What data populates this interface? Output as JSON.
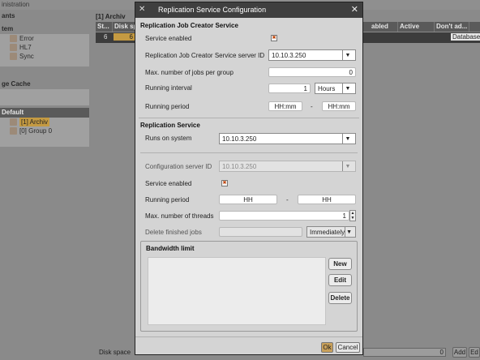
{
  "app": {
    "title_fragment": "inistration",
    "left_panel": {
      "heading1": "ants",
      "heading_system": "tem",
      "system_items": [
        "Error",
        "HL7",
        "Sync"
      ],
      "heading_cache": "ge Cache",
      "heading_default": "Default",
      "default_items": [
        "[1] Archiv",
        "[0] Group 0"
      ]
    },
    "grid": {
      "caption": "[1] Archiv",
      "columns": [
        "St...",
        "Disk sp",
        "abled",
        "Active",
        "Don't ad..."
      ],
      "row": {
        "status": "6",
        "disk": "6",
        "last": "Database"
      }
    },
    "bottom": {
      "disk_label": "Disk space",
      "value": "0",
      "add": "Add",
      "edit": "Ed"
    }
  },
  "dialog": {
    "title": "Replication Service Configuration",
    "close_icon": "close-icon",
    "creator": {
      "section_title": "Replication Job Creator Service",
      "service_enabled_label": "Service enabled",
      "service_enabled": true,
      "server_id_label": "Replication Job Creator Service server ID",
      "server_id_value": "10.10.3.250",
      "max_jobs_label": "Max. number of jobs per group",
      "max_jobs_value": "0",
      "interval_label": "Running interval",
      "interval_value": "1",
      "interval_unit": "Hours",
      "period_label": "Running period",
      "period_from": "HH:mm",
      "period_dash": "-",
      "period_to": "HH:mm"
    },
    "replication": {
      "section_title": "Replication Service",
      "runs_on_label": "Runs on system",
      "runs_on_value": "10.10.3.250",
      "config_id_label": "Configuration server ID",
      "config_id_value": "10.10.3.250",
      "service_enabled_label": "Service enabled",
      "service_enabled": true,
      "period_label": "Running period",
      "period_from": "HH",
      "period_dash": "-",
      "period_to": "HH",
      "threads_label": "Max. number of threads",
      "threads_value": "1",
      "delete_label": "Delete finished jobs",
      "delete_value": "",
      "delete_mode": "Immediately"
    },
    "bandwidth": {
      "title": "Bandwidth limit",
      "new_label": "New",
      "edit_label": "Edit",
      "delete_label": "Delete"
    },
    "footer": {
      "ok_label": "Ok",
      "cancel_label": "Cancel"
    }
  },
  "colors": {
    "titlebar": "#3f3f3f",
    "dialog_bg": "#d4d4d4",
    "highlight": "#c49a42",
    "checkbox_mark": "#c04000"
  }
}
